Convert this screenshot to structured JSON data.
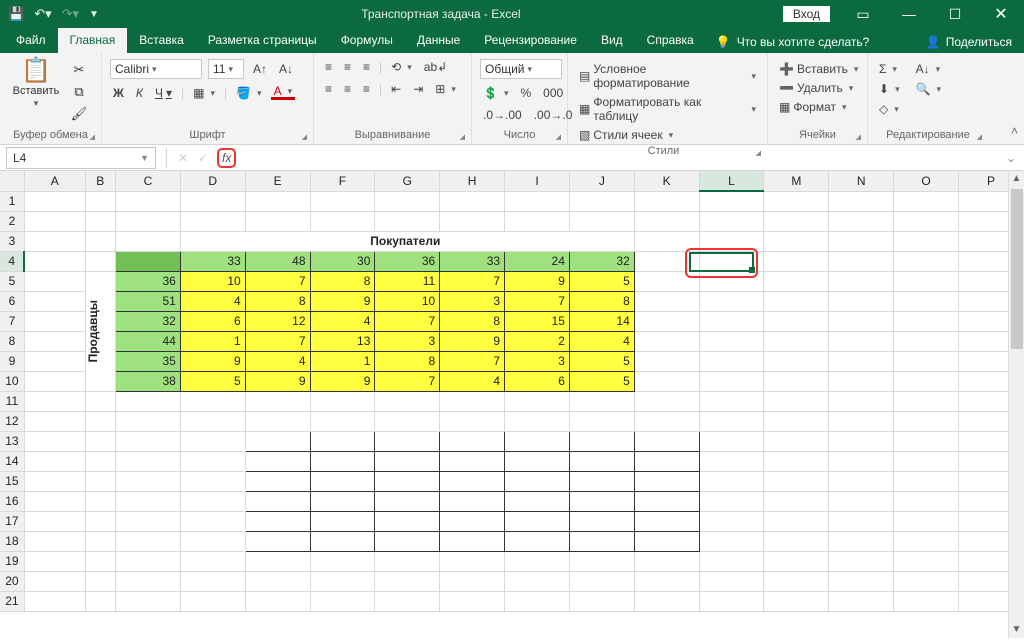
{
  "titlebar": {
    "title": "Транспортная задача  -  Excel",
    "signin": "Вход"
  },
  "tabs": {
    "file": "Файл",
    "home": "Главная",
    "insert": "Вставка",
    "layout": "Разметка страницы",
    "formulas": "Формулы",
    "data": "Данные",
    "review": "Рецензирование",
    "view": "Вид",
    "help": "Справка",
    "tellme": "Что вы хотите сделать?",
    "share": "Поделиться"
  },
  "ribbon": {
    "clipboard": {
      "paste": "Вставить",
      "label": "Буфер обмена"
    },
    "font": {
      "name": "Calibri",
      "size": "11",
      "label": "Шрифт",
      "b": "Ж",
      "i": "К",
      "u": "Ч"
    },
    "align": {
      "label": "Выравнивание"
    },
    "number": {
      "format": "Общий",
      "label": "Число"
    },
    "styles": {
      "cond": "Условное форматирование",
      "table": "Форматировать как таблицу",
      "cell": "Стили ячеек",
      "label": "Стили"
    },
    "cells": {
      "insert": "Вставить",
      "delete": "Удалить",
      "format": "Формат",
      "label": "Ячейки"
    },
    "editing": {
      "label": "Редактирование"
    }
  },
  "fbar": {
    "cellref": "L4",
    "fx": "fx"
  },
  "cols": [
    "A",
    "B",
    "C",
    "D",
    "E",
    "F",
    "G",
    "H",
    "I",
    "J",
    "K",
    "L",
    "M",
    "N",
    "O",
    "P"
  ],
  "rows": [
    "1",
    "2",
    "3",
    "4",
    "5",
    "6",
    "7",
    "8",
    "9",
    "10",
    "11",
    "12",
    "13",
    "14",
    "15",
    "16",
    "17",
    "18",
    "19",
    "20",
    "21"
  ],
  "labels": {
    "buyers": "Покупатели",
    "sellers": "Продавцы"
  },
  "demand": [
    33,
    48,
    30,
    36,
    33,
    24,
    32
  ],
  "supply": [
    36,
    51,
    32,
    44,
    35,
    38
  ],
  "costs": [
    [
      10,
      7,
      8,
      11,
      7,
      9,
      5
    ],
    [
      4,
      8,
      9,
      10,
      3,
      7,
      8
    ],
    [
      6,
      12,
      4,
      7,
      8,
      15,
      14
    ],
    [
      1,
      7,
      13,
      3,
      9,
      2,
      4
    ],
    [
      9,
      4,
      1,
      8,
      7,
      3,
      5
    ],
    [
      5,
      9,
      9,
      7,
      4,
      6,
      5
    ]
  ]
}
